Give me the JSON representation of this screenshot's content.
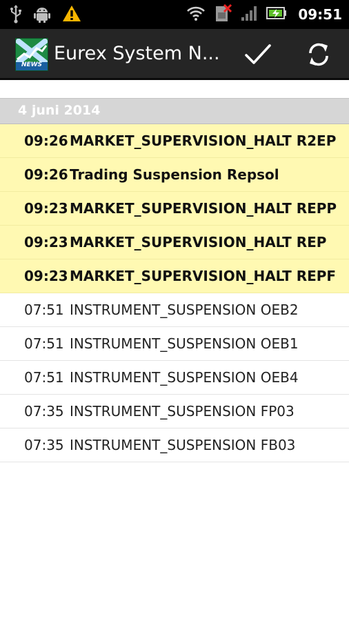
{
  "status_bar": {
    "time": "09:51",
    "icons": [
      "usb-icon",
      "android-debug-icon",
      "warning-icon",
      "wifi-icon",
      "no-sim-icon",
      "signal-icon",
      "battery-charging-icon"
    ]
  },
  "action_bar": {
    "title": "Eurex System N...",
    "logo_text": "NEWS",
    "actions": [
      "check-icon",
      "refresh-icon"
    ]
  },
  "list": {
    "section_header": "4 juni 2014",
    "items": [
      {
        "time": "09:26",
        "title": "MARKET_SUPERVISION_HALT R2EP",
        "unread": true
      },
      {
        "time": "09:26",
        "title": "Trading Suspension Repsol",
        "unread": true
      },
      {
        "time": "09:23",
        "title": "MARKET_SUPERVISION_HALT REPP",
        "unread": true
      },
      {
        "time": "09:23",
        "title": "MARKET_SUPERVISION_HALT REP",
        "unread": true
      },
      {
        "time": "09:23",
        "title": "MARKET_SUPERVISION_HALT REPF",
        "unread": true
      },
      {
        "time": "07:51",
        "title": "INSTRUMENT_SUSPENSION OEB2",
        "unread": false
      },
      {
        "time": "07:51",
        "title": "INSTRUMENT_SUSPENSION OEB1",
        "unread": false
      },
      {
        "time": "07:51",
        "title": "INSTRUMENT_SUSPENSION OEB4",
        "unread": false
      },
      {
        "time": "07:35",
        "title": "INSTRUMENT_SUSPENSION FP03",
        "unread": false
      },
      {
        "time": "07:35",
        "title": "INSTRUMENT_SUSPENSION FB03",
        "unread": false
      }
    ]
  },
  "colors": {
    "unread_bg": "#fff9b2",
    "section_bg": "#d6d6d6",
    "actionbar_bg": "#252525",
    "logo_green": "#1a7a3a",
    "warning": "#f7b500"
  }
}
